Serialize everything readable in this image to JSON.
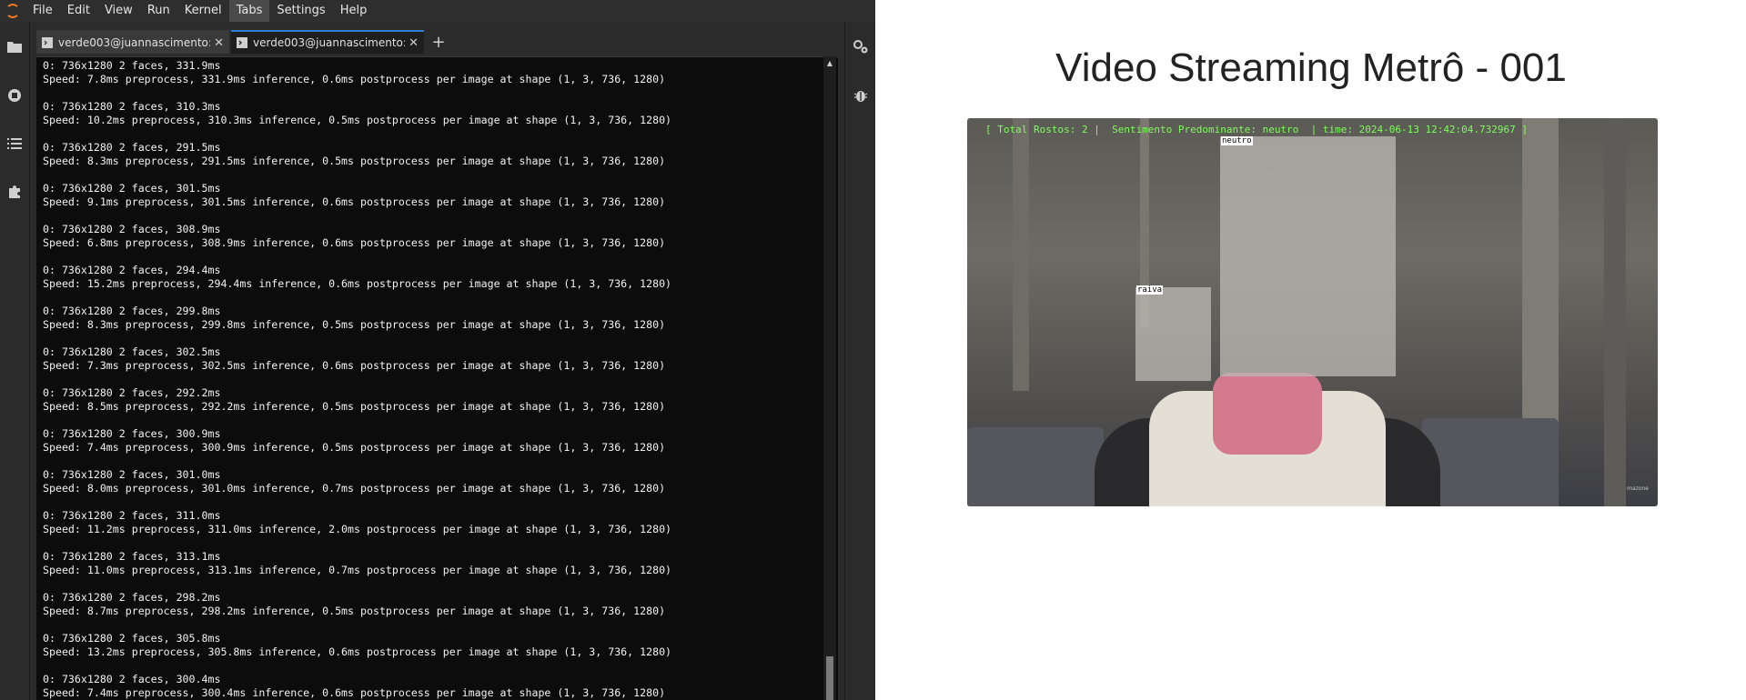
{
  "menubar": {
    "items": [
      "File",
      "Edit",
      "View",
      "Run",
      "Kernel",
      "Tabs",
      "Settings",
      "Help"
    ],
    "active": "Tabs"
  },
  "tabs": [
    {
      "label": "verde003@juannascimento:",
      "active": false
    },
    {
      "label": "verde003@juannascimento:",
      "active": true
    }
  ],
  "terminal": {
    "entries": [
      {
        "line1": "0: 736x1280 2 faces, 331.9ms",
        "line2": "Speed: 7.8ms preprocess, 331.9ms inference, 0.6ms postprocess per image at shape (1, 3, 736, 1280)"
      },
      {
        "line1": "0: 736x1280 2 faces, 310.3ms",
        "line2": "Speed: 10.2ms preprocess, 310.3ms inference, 0.5ms postprocess per image at shape (1, 3, 736, 1280)"
      },
      {
        "line1": "0: 736x1280 2 faces, 291.5ms",
        "line2": "Speed: 8.3ms preprocess, 291.5ms inference, 0.5ms postprocess per image at shape (1, 3, 736, 1280)"
      },
      {
        "line1": "0: 736x1280 2 faces, 301.5ms",
        "line2": "Speed: 9.1ms preprocess, 301.5ms inference, 0.6ms postprocess per image at shape (1, 3, 736, 1280)"
      },
      {
        "line1": "0: 736x1280 2 faces, 308.9ms",
        "line2": "Speed: 6.8ms preprocess, 308.9ms inference, 0.6ms postprocess per image at shape (1, 3, 736, 1280)"
      },
      {
        "line1": "0: 736x1280 2 faces, 294.4ms",
        "line2": "Speed: 15.2ms preprocess, 294.4ms inference, 0.6ms postprocess per image at shape (1, 3, 736, 1280)"
      },
      {
        "line1": "0: 736x1280 2 faces, 299.8ms",
        "line2": "Speed: 8.3ms preprocess, 299.8ms inference, 0.5ms postprocess per image at shape (1, 3, 736, 1280)"
      },
      {
        "line1": "0: 736x1280 2 faces, 302.5ms",
        "line2": "Speed: 7.3ms preprocess, 302.5ms inference, 0.6ms postprocess per image at shape (1, 3, 736, 1280)"
      },
      {
        "line1": "0: 736x1280 2 faces, 292.2ms",
        "line2": "Speed: 8.5ms preprocess, 292.2ms inference, 0.5ms postprocess per image at shape (1, 3, 736, 1280)"
      },
      {
        "line1": "0: 736x1280 2 faces, 300.9ms",
        "line2": "Speed: 7.4ms preprocess, 300.9ms inference, 0.5ms postprocess per image at shape (1, 3, 736, 1280)"
      },
      {
        "line1": "0: 736x1280 2 faces, 301.0ms",
        "line2": "Speed: 8.0ms preprocess, 301.0ms inference, 0.7ms postprocess per image at shape (1, 3, 736, 1280)"
      },
      {
        "line1": "0: 736x1280 2 faces, 311.0ms",
        "line2": "Speed: 11.2ms preprocess, 311.0ms inference, 2.0ms postprocess per image at shape (1, 3, 736, 1280)"
      },
      {
        "line1": "0: 736x1280 2 faces, 313.1ms",
        "line2": "Speed: 11.0ms preprocess, 313.1ms inference, 0.7ms postprocess per image at shape (1, 3, 736, 1280)"
      },
      {
        "line1": "0: 736x1280 2 faces, 298.2ms",
        "line2": "Speed: 8.7ms preprocess, 298.2ms inference, 0.5ms postprocess per image at shape (1, 3, 736, 1280)"
      },
      {
        "line1": "0: 736x1280 2 faces, 305.8ms",
        "line2": "Speed: 13.2ms preprocess, 305.8ms inference, 0.6ms postprocess per image at shape (1, 3, 736, 1280)"
      },
      {
        "line1": "0: 736x1280 2 faces, 300.4ms",
        "line2": "Speed: 7.4ms preprocess, 300.4ms inference, 0.6ms postprocess per image at shape (1, 3, 736, 1280)"
      }
    ]
  },
  "viewer": {
    "title": "Video Streaming Metrô - 001",
    "overlay": "[ Total Rostos: 2 |  Sentimento Predominante: neutro  | time: 2024-06-13 12:42:04.732967 ]",
    "faces": [
      {
        "label": "neutro"
      },
      {
        "label": "raiva"
      }
    ],
    "watermark": "mazone"
  },
  "colors": {
    "accent": "#2f7fd4",
    "overlay_text": "#7cff5a",
    "terminal_bg": "#0c0c0c"
  }
}
